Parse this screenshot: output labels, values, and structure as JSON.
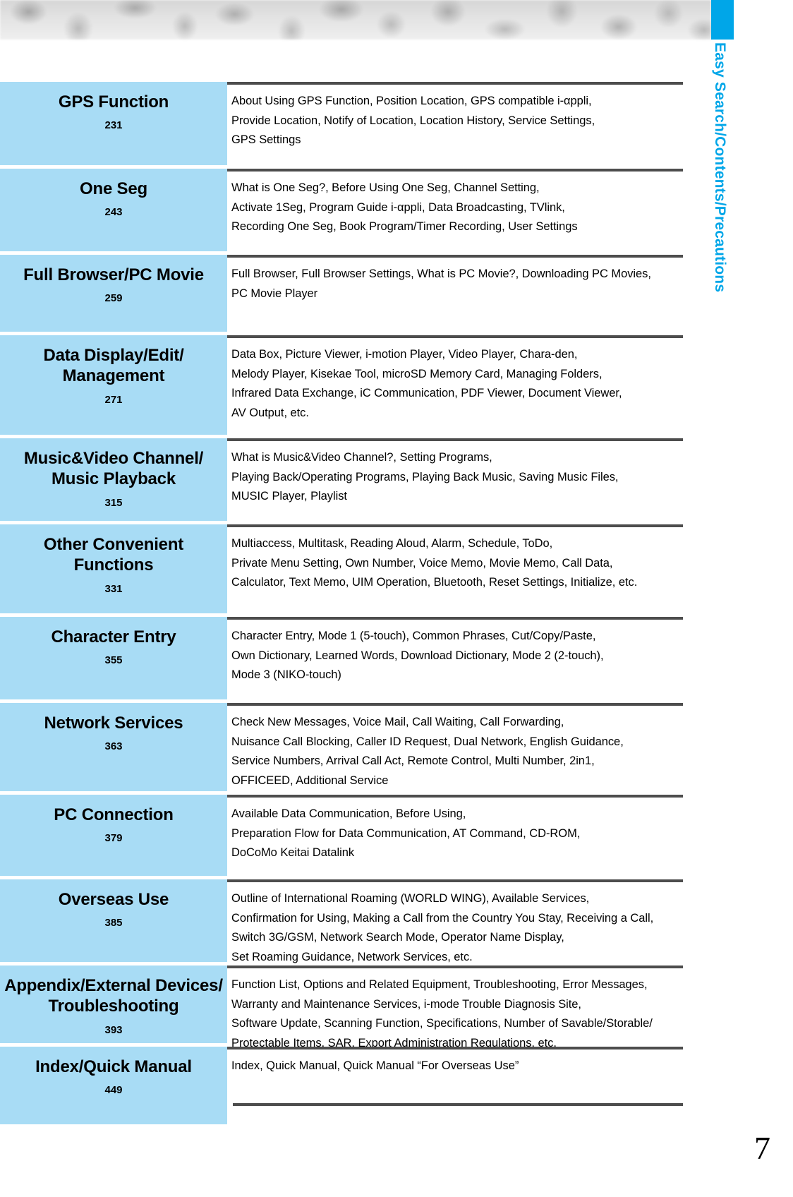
{
  "side_tab": {
    "label": "Easy Search/Contents/Precautions",
    "color": "#00a6e8"
  },
  "page_number": "7",
  "theme": {
    "category_bg": "#a8dcf5",
    "rule_color": "#4d4d4d"
  },
  "contents": [
    {
      "title": "GPS Function",
      "page": "231",
      "lines": [
        "About Using GPS Function, Position Location, GPS compatible i-αppli,",
        "Provide Location, Notify of Location, Location History, Service Settings,",
        "GPS Settings"
      ]
    },
    {
      "title": "One Seg",
      "page": "243",
      "lines": [
        "What is One Seg?, Before Using One Seg, Channel Setting,",
        "Activate 1Seg, Program Guide i-αppli, Data Broadcasting, TVlink,",
        "Recording One Seg, Book Program/Timer Recording, User Settings"
      ]
    },
    {
      "title": "Full Browser/PC Movie",
      "page": "259",
      "lines": [
        "Full Browser, Full Browser Settings, What is PC Movie?, Downloading PC Movies,",
        "PC Movie Player"
      ]
    },
    {
      "title": "Data Display/Edit/\nManagement",
      "page": "271",
      "lines": [
        "Data Box, Picture Viewer, i-motion Player, Video Player, Chara-den,",
        "Melody Player, Kisekae Tool, microSD Memory Card, Managing Folders,",
        "Infrared Data Exchange, iC Communication, PDF Viewer, Document Viewer,",
        "AV Output, etc."
      ]
    },
    {
      "title": "Music&Video Channel/\nMusic Playback",
      "page": "315",
      "lines": [
        "What is Music&Video Channel?, Setting Programs,",
        "Playing Back/Operating Programs, Playing Back Music, Saving Music Files,",
        "MUSIC Player, Playlist"
      ]
    },
    {
      "title": "Other Convenient\nFunctions",
      "page": "331",
      "lines": [
        "Multiaccess, Multitask, Reading Aloud, Alarm, Schedule, ToDo,",
        "Private Menu Setting, Own Number, Voice Memo, Movie Memo, Call Data,",
        "Calculator, Text Memo, UIM Operation, Bluetooth, Reset Settings, Initialize, etc."
      ]
    },
    {
      "title": "Character Entry",
      "page": "355",
      "lines": [
        "Character Entry, Mode 1 (5-touch), Common Phrases, Cut/Copy/Paste,",
        "Own Dictionary, Learned Words, Download Dictionary, Mode 2 (2-touch),",
        "Mode 3 (NIKO-touch)"
      ]
    },
    {
      "title": "Network Services",
      "page": "363",
      "lines": [
        "Check New Messages, Voice Mail, Call Waiting, Call Forwarding,",
        "Nuisance Call Blocking, Caller ID Request, Dual Network, English Guidance,",
        "Service Numbers, Arrival Call Act, Remote Control, Multi Number, 2in1,",
        "OFFICEED, Additional Service"
      ]
    },
    {
      "title": "PC Connection",
      "page": "379",
      "lines": [
        "Available Data Communication, Before Using,",
        "Preparation Flow for Data Communication, AT Command, CD-ROM,",
        "DoCoMo Keitai Datalink"
      ]
    },
    {
      "title": "Overseas Use",
      "page": "385",
      "lines": [
        "Outline of International Roaming (WORLD WING), Available Services,",
        "Confirmation for Using, Making a Call from the Country You Stay, Receiving a Call,",
        "Switch 3G/GSM, Network Search Mode, Operator Name Display,",
        "Set Roaming Guidance, Network Services, etc."
      ]
    },
    {
      "title": "Appendix/External Devices/\nTroubleshooting",
      "page": "393",
      "lines": [
        "Function List, Options and Related Equipment, Troubleshooting, Error Messages,",
        "Warranty and Maintenance Services, i-mode Trouble Diagnosis Site,",
        "Software Update, Scanning Function, Specifications, Number of Savable/Storable/",
        "Protectable Items, SAR, Export Administration Regulations, etc."
      ]
    },
    {
      "title": "Index/Quick Manual",
      "page": "449",
      "lines": [
        "Index, Quick Manual, Quick Manual “For Overseas Use”"
      ]
    }
  ]
}
